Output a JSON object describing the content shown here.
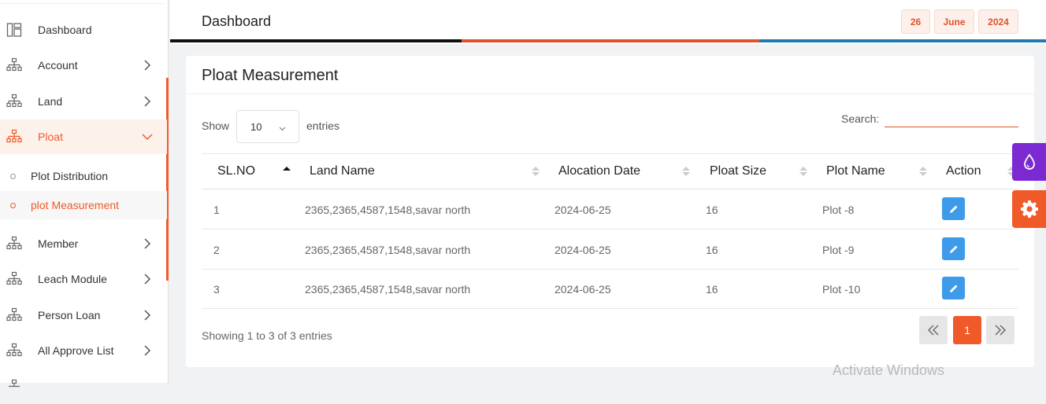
{
  "sidebar": {
    "items": [
      {
        "label": "Dashboard",
        "icon": "dashboard-icon"
      },
      {
        "label": "Account",
        "icon": "sitemap-icon"
      },
      {
        "label": "Land",
        "icon": "sitemap-icon"
      },
      {
        "label": "Ploat",
        "icon": "sitemap-icon"
      },
      {
        "label": "Member",
        "icon": "sitemap-icon"
      },
      {
        "label": "Leach Module",
        "icon": "sitemap-icon"
      },
      {
        "label": "Person Loan",
        "icon": "sitemap-icon"
      },
      {
        "label": "All Approve List",
        "icon": "sitemap-icon"
      }
    ],
    "subitems": [
      {
        "label": "Plot Distribution"
      },
      {
        "label": "plot Measurement"
      }
    ]
  },
  "header": {
    "title": "Dashboard",
    "date": {
      "day": "26",
      "month": "June",
      "year": "2024"
    }
  },
  "card": {
    "title": "Ploat Measurement",
    "show_label": "Show",
    "entries_value": "10",
    "entries_label": "entries",
    "search_label": "Search:",
    "search_value": "",
    "columns": [
      "SL.NO",
      "Land Name",
      "Alocation Date",
      "Ploat Size",
      "Plot Name",
      "Action"
    ],
    "rows": [
      {
        "sl": "1",
        "land": "2365,2365,4587,1548,savar north",
        "date": "2024-06-25",
        "size": "16",
        "plot": "Plot -8"
      },
      {
        "sl": "2",
        "land": "2365,2365,4587,1548,savar north",
        "date": "2024-06-25",
        "size": "16",
        "plot": "Plot -9"
      },
      {
        "sl": "3",
        "land": "2365,2365,4587,1548,savar north",
        "date": "2024-06-25",
        "size": "16",
        "plot": "Plot -10"
      }
    ],
    "info": "Showing 1 to 3 of 3 entries",
    "pagination": {
      "prev": "«",
      "current": "1",
      "next": "»"
    }
  },
  "watermark": "Activate Windows",
  "colors": {
    "accent": "#f05a28",
    "edit": "#3d9be9",
    "purple": "#7b2ad1",
    "blue_bar": "#1f7ab0"
  }
}
